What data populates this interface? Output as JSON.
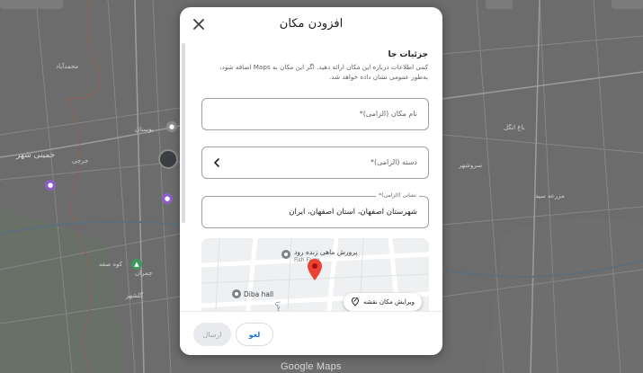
{
  "map": {
    "labels": {
      "khomeini_shahr": "خمینی شهر",
      "mohammadabad": "محمدآباد",
      "bustan": "بوستان",
      "chamran": "چمران",
      "kuhsangi": "کوه صفه",
      "bag_angel": "باغ انگل",
      "isfahan_right": "سروشهر",
      "mazraeh": "مزرعه سید",
      "golshahr": "گلشهر",
      "jarchi": "جرچی"
    },
    "google_logo": "Google Maps"
  },
  "dialog": {
    "title": "افزودن مکان",
    "close_icon": "close-icon",
    "details_title": "جزئیات جا",
    "details_desc": "کمی اطلاعات درباره این مکان ارائه دهید. اگر این مکان به Maps اضافه شود، به‌طور عمومی نشان داده خواهد شد.",
    "place_name_placeholder": "نام مکان (الزامی)*",
    "category_placeholder": "دسته (الزامی)*",
    "category_chevron_icon": "chevron-left-icon",
    "address_label": "نشانی (الزامی)*",
    "address_value": "شهرستان اصفهان، استان اصفهان، ایران",
    "preview": {
      "poi_fish_farm": "پرورش ماهی زنده رود",
      "poi_fish_farm_en": "Fish Farm",
      "poi_diba": "Diba hall",
      "street": "خیابان صحرا",
      "edit_location": "ویرایش مکان نقشه",
      "edit_icon": "edit-location-icon",
      "pin_color": "#ea4335"
    },
    "buttons": {
      "send": "ارسال",
      "cancel": "لغو"
    }
  },
  "colors": {
    "accent": "#1a73e8",
    "dialog_bg": "#ffffff",
    "map_dim": "#6e6f6e"
  }
}
